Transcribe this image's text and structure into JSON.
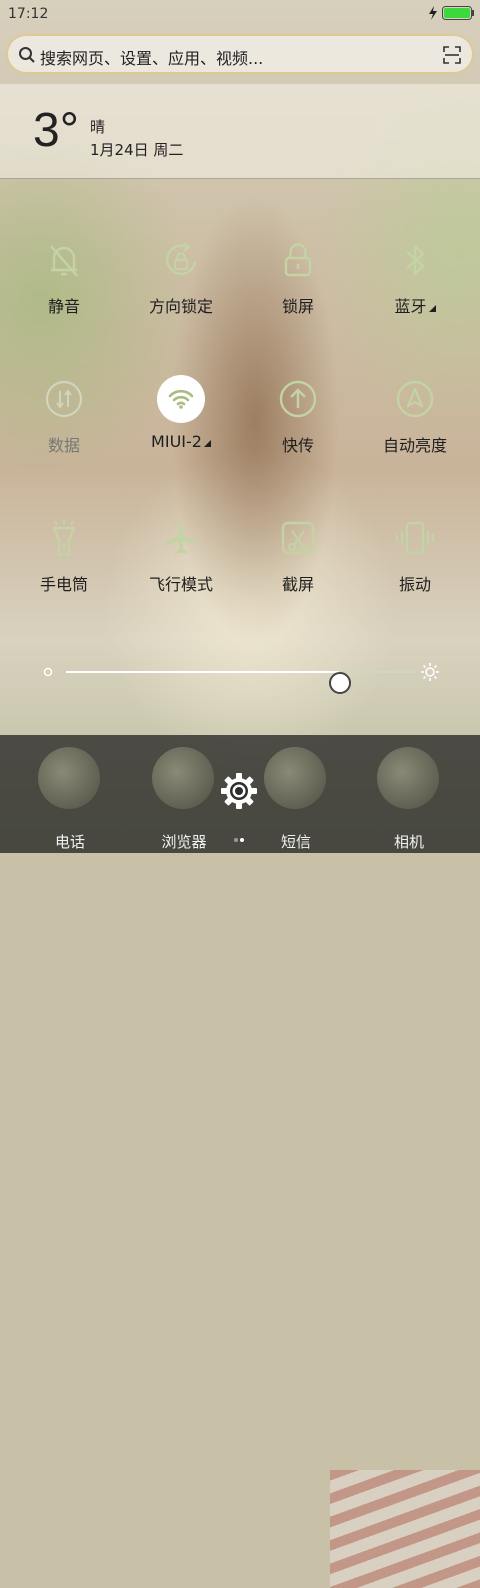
{
  "status": {
    "time": "17:12",
    "battery_color": "#3bd93b"
  },
  "search": {
    "placeholder": "搜索网页、设置、应用、视频..."
  },
  "weather": {
    "temperature": "3°",
    "condition": "晴",
    "date": "1月24日 周二"
  },
  "toggles": [
    {
      "label": "静音",
      "icon": "mute-bell-icon",
      "active": false,
      "enabled": true
    },
    {
      "label": "方向锁定",
      "icon": "rotation-lock-icon",
      "active": false,
      "enabled": true
    },
    {
      "label": "锁屏",
      "icon": "lock-icon",
      "active": false,
      "enabled": true
    },
    {
      "label": "蓝牙",
      "icon": "bluetooth-icon",
      "active": false,
      "enabled": true,
      "has_submenu": true
    },
    {
      "label": "数据",
      "icon": "mobile-data-icon",
      "active": false,
      "enabled": false
    },
    {
      "label": "MIUI-2",
      "icon": "wifi-icon",
      "active": true,
      "enabled": true,
      "has_submenu": true
    },
    {
      "label": "快传",
      "icon": "quick-transfer-icon",
      "active": false,
      "enabled": true
    },
    {
      "label": "自动亮度",
      "icon": "auto-brightness-icon",
      "active": false,
      "enabled": true
    },
    {
      "label": "手电筒",
      "icon": "flashlight-icon",
      "active": false,
      "enabled": true
    },
    {
      "label": "飞行模式",
      "icon": "airplane-icon",
      "active": false,
      "enabled": true
    },
    {
      "label": "截屏",
      "icon": "screenshot-icon",
      "active": false,
      "enabled": true
    },
    {
      "label": "振动",
      "icon": "vibrate-icon",
      "active": false,
      "enabled": true
    }
  ],
  "brightness": {
    "level": 0.78
  },
  "dock": {
    "apps": [
      {
        "label": "电话",
        "icon": "phone-app-icon"
      },
      {
        "label": "浏览器",
        "icon": "browser-app-icon"
      },
      {
        "label": "短信",
        "icon": "messages-app-icon"
      },
      {
        "label": "相机",
        "icon": "camera-app-icon"
      }
    ],
    "page_indicator": {
      "pages": 2,
      "current": 2
    }
  },
  "colors": {
    "icon_accent": "#c4d3a4",
    "active_icon": "#a8bb80"
  }
}
